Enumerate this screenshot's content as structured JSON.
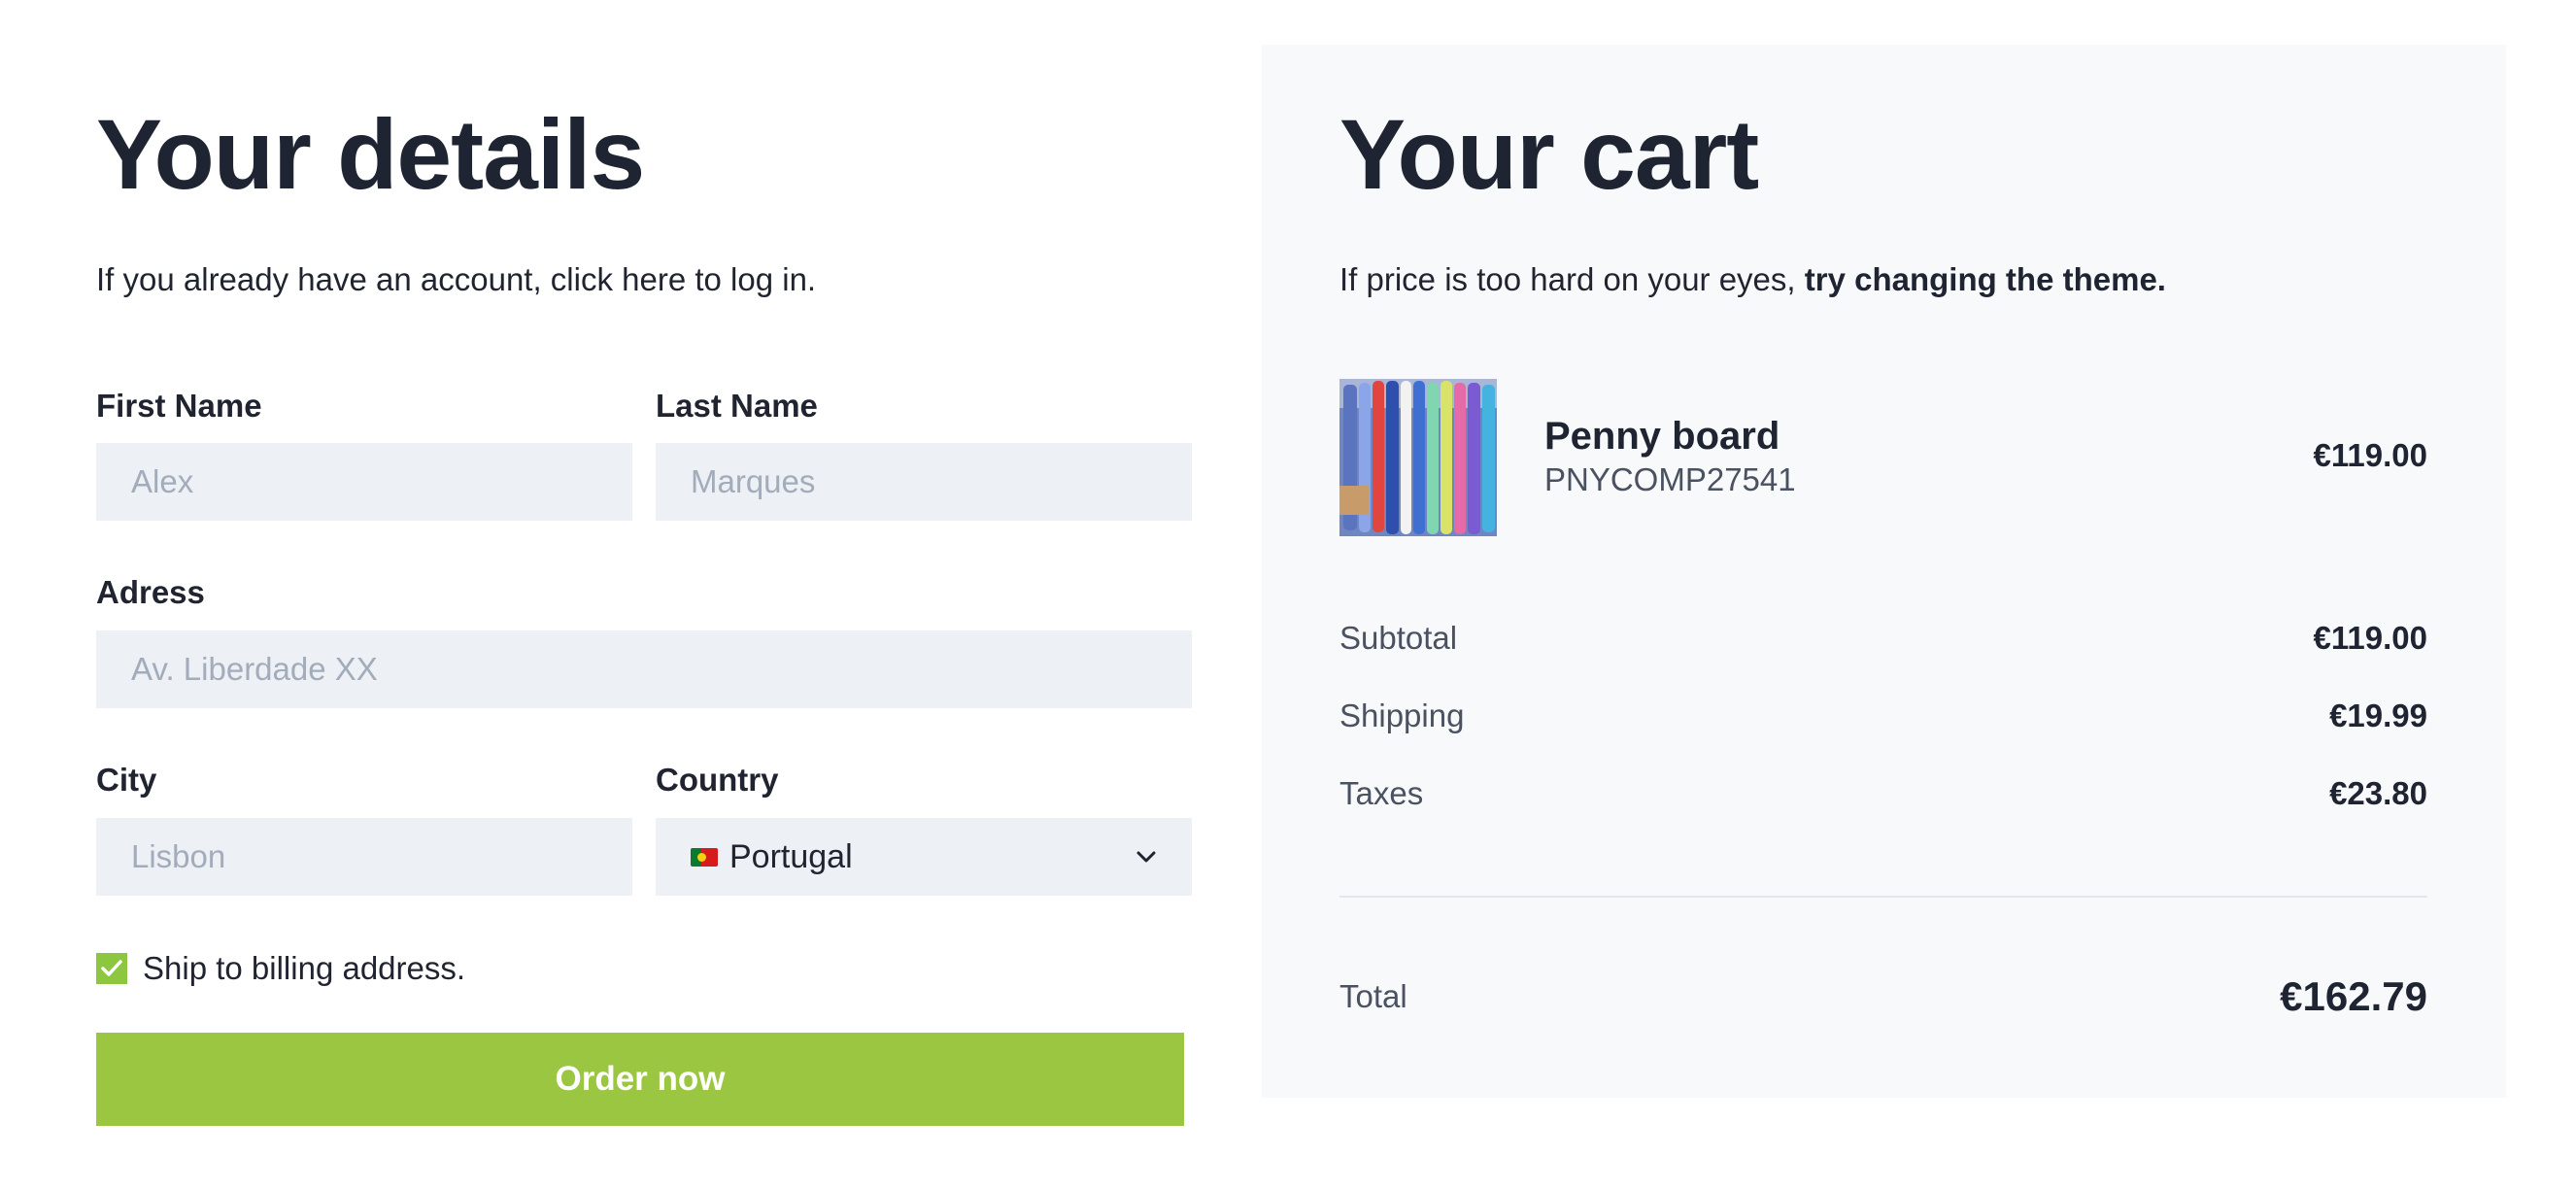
{
  "details": {
    "title": "Your details",
    "login_text": "If you already have an account, click here to log in.",
    "first_name": {
      "label": "First Name",
      "placeholder": "Alex"
    },
    "last_name": {
      "label": "Last Name",
      "placeholder": "Marques"
    },
    "address": {
      "label": "Adress",
      "placeholder": "Av. Liberdade XX"
    },
    "city": {
      "label": "City",
      "placeholder": "Lisbon"
    },
    "country": {
      "label": "Country",
      "selected": "Portugal",
      "flag_icon": "portugal-flag-icon"
    },
    "ship_checkbox": {
      "label": "Ship to billing address.",
      "checked": true
    },
    "order_button": "Order now"
  },
  "cart": {
    "title": "Your cart",
    "theme_text_prefix": "If price is too hard on your eyes, ",
    "theme_text_link": "try changing the theme.",
    "item": {
      "name": "Penny board",
      "sku": "PNYCOMP27541",
      "price": "€119.00"
    },
    "subtotal": {
      "label": "Subtotal",
      "value": "€119.00"
    },
    "shipping": {
      "label": "Shipping",
      "value": "€19.99"
    },
    "taxes": {
      "label": "Taxes",
      "value": "€23.80"
    },
    "total": {
      "label": "Total",
      "value": "€162.79"
    }
  },
  "colors": {
    "accent": "#9bc642",
    "checkbox": "#8dc63f",
    "input_bg": "#edf0f5",
    "cart_bg": "#f8f9fb",
    "heading": "#1e2431"
  }
}
